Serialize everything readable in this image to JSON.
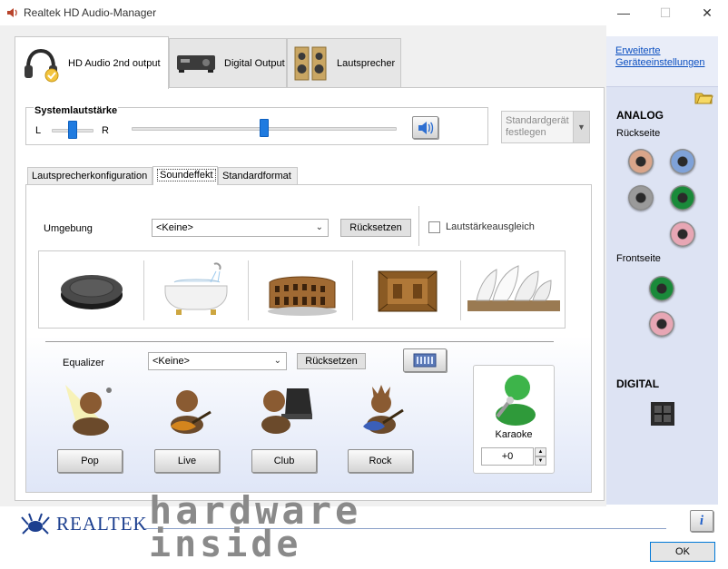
{
  "window": {
    "title": "Realtek HD Audio-Manager",
    "minimize": "—",
    "maximize": "☐",
    "close": "✕"
  },
  "device_tabs": [
    {
      "label": "HD Audio 2nd output",
      "icon": "headphones-icon"
    },
    {
      "label": "Digital Output",
      "icon": "digital-receiver-icon"
    },
    {
      "label": "Lautsprecher",
      "icon": "speaker-icon"
    }
  ],
  "volume": {
    "title": "Systemlautstärke",
    "left_label": "L",
    "right_label": "R",
    "balance": 0.5,
    "level": 0.5
  },
  "default_device": {
    "label_line1": "Standardgerät",
    "label_line2": "festlegen"
  },
  "inner_tabs": [
    "Lautsprecherkonfiguration",
    "Soundeffekt",
    "Standardformat"
  ],
  "environment": {
    "label": "Umgebung",
    "selected": "<Keine>",
    "reset_label": "Rücksetzen",
    "loudness_label": "Lautstärkeausgleich",
    "presets": [
      "stone-disc-icon",
      "bathtub-icon",
      "colosseum-icon",
      "wooden-room-icon",
      "opera-house-icon"
    ]
  },
  "equalizer": {
    "label": "Equalizer",
    "selected": "<Keine>",
    "reset_label": "Rücksetzen",
    "presets": [
      "Pop",
      "Live",
      "Club",
      "Rock"
    ]
  },
  "karaoke": {
    "label": "Karaoke",
    "value": "+0"
  },
  "sidebar": {
    "link_line1": "Erweiterte",
    "link_line2": "Geräteeinstellungen",
    "analog_title": "ANALOG",
    "rear_label": "Rückseite",
    "front_label": "Frontseite",
    "digital_title": "DIGITAL",
    "rear_jack_colors": [
      "#d9a58a",
      "#7fa2d8",
      "#9a9a9a",
      "#1a8a3a",
      "#e7a6b4"
    ],
    "front_jack_colors": [
      "#1a8a3a",
      "#e7a6b4"
    ]
  },
  "footer": {
    "brand": "REALTEK",
    "ok_label": "OK",
    "info": "i",
    "watermark_line1": "hardware",
    "watermark_line2": "inside"
  }
}
